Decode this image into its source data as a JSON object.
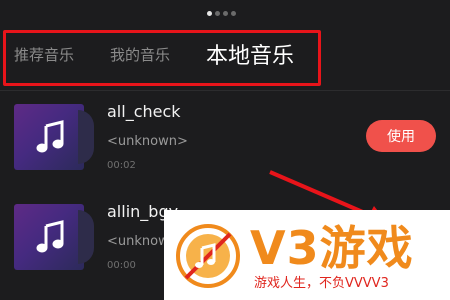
{
  "pager": {
    "total": 4,
    "active": 0
  },
  "tabs": [
    {
      "label": "推荐音乐",
      "selected": false
    },
    {
      "label": "我的音乐",
      "selected": false
    },
    {
      "label": "本地音乐",
      "selected": true
    }
  ],
  "songs": [
    {
      "title": "all_check",
      "artist": "<unknown>",
      "duration": "00:02",
      "action_label": "使用"
    },
    {
      "title": "allin_bgy",
      "artist": "<unknown>",
      "duration": "00:00"
    }
  ],
  "watermark": {
    "brand": "V3游戏",
    "slogan": "游戏人生，不负VVVV3"
  },
  "colors": {
    "background": "#1c1c1e",
    "accent": "#f0514b",
    "annotation_red": "#e8141a",
    "watermark_orange": "#f08a1c"
  },
  "icons": [
    "music-note-icon",
    "annotation-arrow"
  ]
}
